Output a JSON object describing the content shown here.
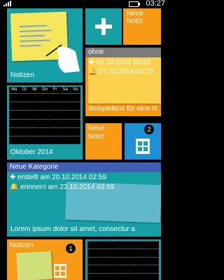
{
  "status_bar": {
    "time": "03:27"
  },
  "tiles": {
    "notizen_top": {
      "label": "Notizen",
      "color": "#16a0a5"
    },
    "neue_notiz_large": {
      "label": "Neue\nNotiz",
      "color": "#f79a16"
    },
    "ohne": {
      "title": "ohne",
      "created": "20.10.2014 03:23",
      "remind": "27.10.2014 04:23",
      "text": "Beispieltext für eine N",
      "color": "#f79a16"
    },
    "calendar_oct": {
      "label": "Oktober 2014",
      "color": "#16a0a5",
      "weekdays": [
        "Mo",
        "Di",
        "Mi",
        "Do",
        "Fr",
        "Sa",
        "So"
      ]
    },
    "neue_notiz_small": {
      "label": "Neue\nNotiz",
      "color": "#f79a16"
    },
    "pages_icon_tile": {
      "badge": "2",
      "color": "#1e90d4"
    },
    "kategorie": {
      "title": "Neue Kategorie",
      "created_label": "erstellt am",
      "created": "20.10.2014 02:59",
      "remind_label": "erinnern am",
      "remind": "23.10.2014 03:59",
      "text": "Lorem ipsum dolor sit amet, consectur a",
      "color": "#16a0a5"
    },
    "notizen_bottom": {
      "label": "Notizen",
      "badge": "1",
      "color": "#f79a16"
    }
  }
}
